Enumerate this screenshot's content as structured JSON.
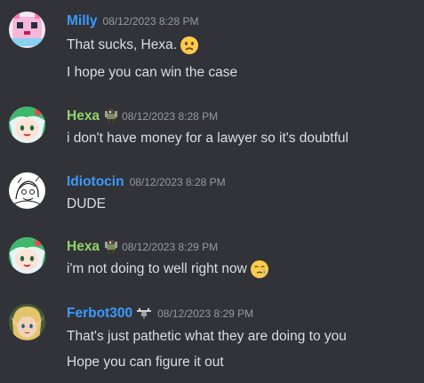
{
  "colors": {
    "background": "#313338",
    "text": "#dbdee1",
    "timestamp": "#949ba4",
    "name_blue": "#3b9aff",
    "name_green": "#8fd46b"
  },
  "messages": [
    {
      "username": "Milly",
      "timestamp": "08/12/2023 8:28 PM",
      "lines": [
        "That sucks, Hexa.",
        "I hope you can win the case"
      ],
      "emoji": "frowning-face-emoji"
    },
    {
      "username": "Hexa",
      "badge": "pixel-character-badge-icon",
      "timestamp": "08/12/2023 8:28 PM",
      "lines": [
        "i don't have money for a lawyer so it's doubtful"
      ]
    },
    {
      "username": "Idiotocin",
      "timestamp": "08/12/2023 8:28 PM",
      "lines": [
        "DUDE"
      ]
    },
    {
      "username": "Hexa",
      "badge": "pixel-character-badge-icon",
      "timestamp": "08/12/2023 8:29 PM",
      "lines": [
        "i'm not doing to well right now"
      ],
      "emoji": "sad-tear-face-emoji"
    },
    {
      "username": "Ferbot300",
      "badge": "drone-badge-icon",
      "timestamp": "08/12/2023 8:29 PM",
      "lines": [
        "That's just pathetic what they are doing to you",
        "Hope you can figure it out"
      ]
    }
  ]
}
